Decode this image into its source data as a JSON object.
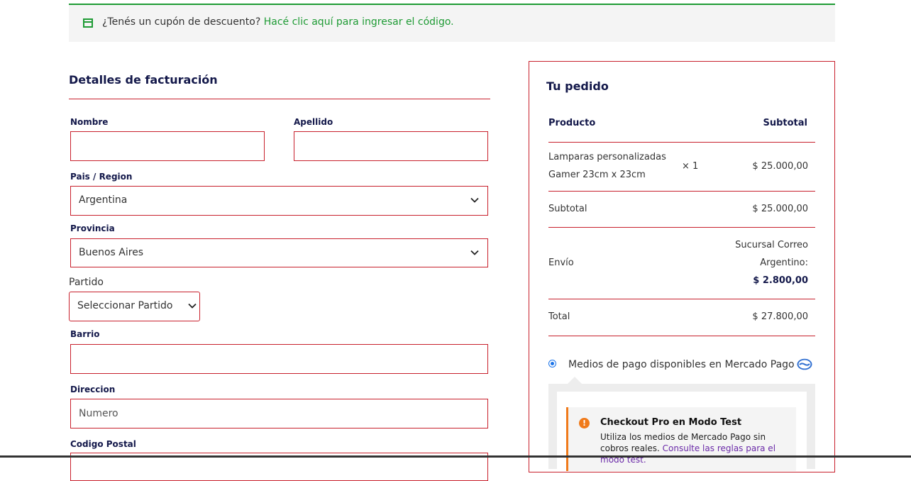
{
  "coupon": {
    "text": "¿Tenés un cupón de descuento? ",
    "link": "Hacé clic aquí para ingresar el código."
  },
  "billing": {
    "title": "Detalles de facturación",
    "nombre_label": "Nombre",
    "nombre_value": "",
    "apellido_label": "Apellido",
    "apellido_value": "",
    "pais_label": "Pais / Region",
    "pais_value": "Argentina",
    "provincia_label": "Provincia",
    "provincia_value": "Buenos Aires",
    "partido_label": "Partido",
    "partido_value": "Seleccionar Partido",
    "barrio_label": "Barrio",
    "barrio_value": "",
    "direccion_label": "Direccion",
    "direccion_placeholder": "Numero",
    "cp_label": "Codigo Postal"
  },
  "order": {
    "title": "Tu pedido",
    "col_product": "Producto",
    "col_subtotal": "Subtotal",
    "item_name_line1": "Lamparas personalizadas",
    "item_name_line2": "Gamer 23cm x 23cm",
    "item_qty": "× 1",
    "item_price": "$ 25.000,00",
    "subtotal_label": "Subtotal",
    "subtotal_value": "$ 25.000,00",
    "envio_label": "Envío",
    "envio_line1": "Sucursal Correo",
    "envio_line2": "Argentino:",
    "envio_price": "$ 2.800,00",
    "total_label": "Total",
    "total_value": "$ 27.800,00"
  },
  "payment": {
    "option_label": "Medios de pago disponibles en Mercado Pago",
    "notice_title": "Checkout Pro en Modo Test",
    "notice_body": "Utiliza los medios de Mercado Pago sin cobros reales. ",
    "notice_link": "Consulte las reglas para el modo test."
  },
  "colors": {
    "accent_red": "#c8202c",
    "success_green": "#1f9b35",
    "heading_navy": "#13184a",
    "warning_orange": "#f07a1a"
  }
}
